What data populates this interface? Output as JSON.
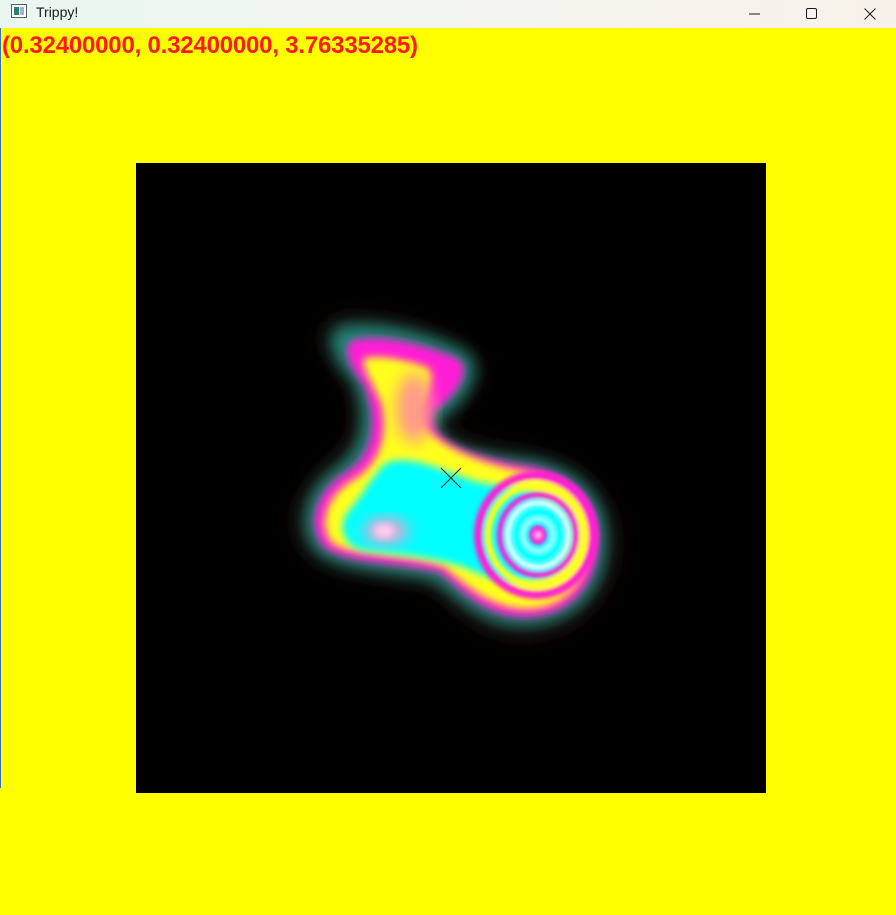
{
  "window": {
    "title": "Trippy!",
    "icon": "app-window-icon",
    "controls": {
      "minimize": "minimize-icon",
      "maximize": "maximize-icon",
      "close": "close-icon"
    }
  },
  "overlay": {
    "coordinates_text": "(0.32400000, 0.32400000, 3.76335285)"
  },
  "colors": {
    "background": "#ffff00",
    "coordinates_text": "#ff1a1a",
    "canvas": "#000000",
    "palette": [
      "#ff00ff",
      "#ffff00",
      "#00ffff",
      "#ffffff",
      "#ff88cc",
      "#2e8b7a"
    ]
  },
  "canvas": {
    "description_icon": "crosshair-icon"
  }
}
